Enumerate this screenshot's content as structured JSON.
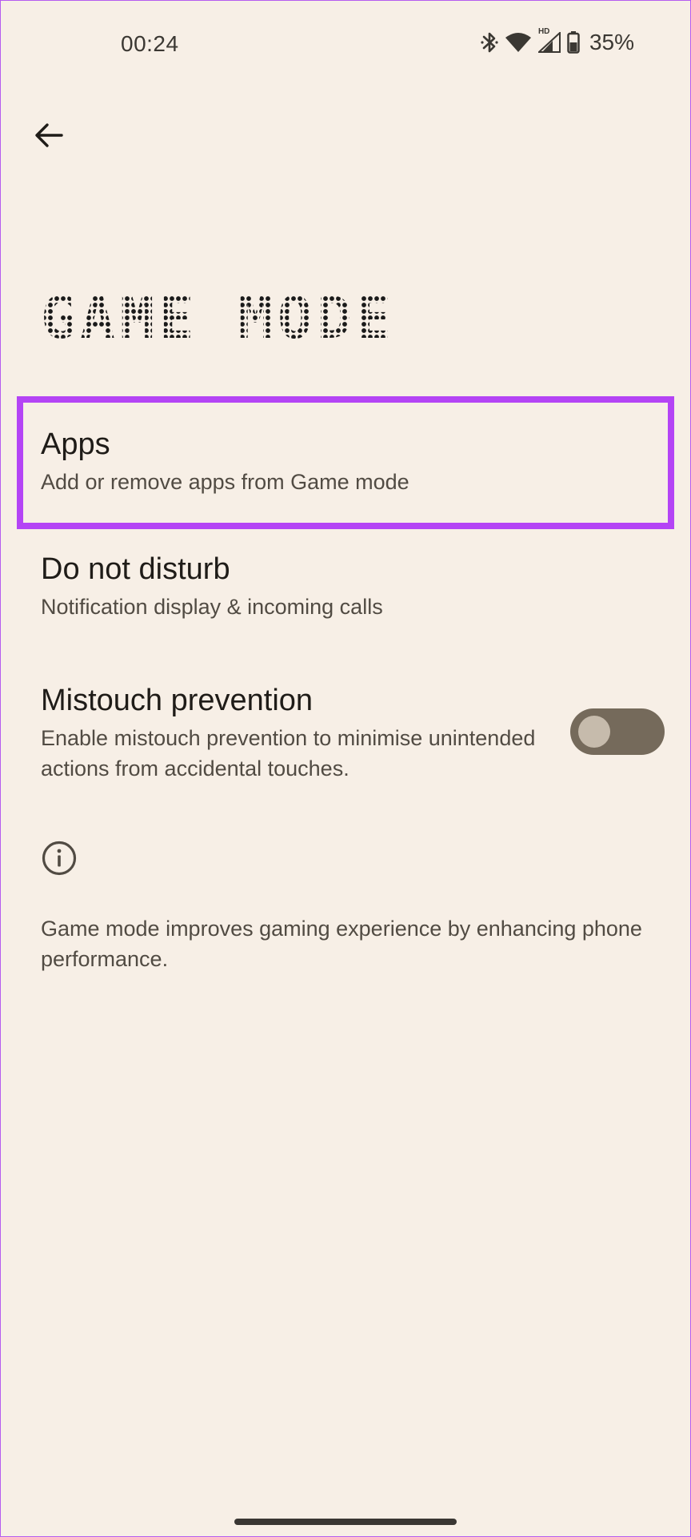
{
  "status_bar": {
    "time": "00:24",
    "network_badge": "HD",
    "battery_percent": "35%",
    "icons": [
      "bluetooth-icon",
      "wifi-icon",
      "cellular-signal-icon",
      "battery-icon"
    ]
  },
  "header": {
    "back_icon": "arrow-left-icon",
    "title": "GAME MODE"
  },
  "settings": [
    {
      "title": "Apps",
      "summary": "Add or remove apps from Game mode",
      "highlighted": true
    },
    {
      "title": "Do not disturb",
      "summary": "Notification display & incoming calls"
    },
    {
      "title": "Mistouch prevention",
      "summary": "Enable mistouch prevention to minimise unintended actions from accidental touches.",
      "toggle_on": false
    }
  ],
  "footer": {
    "icon": "info-icon",
    "text": "Game mode improves gaming experience by enhancing phone performance."
  },
  "colors": {
    "background": "#f7efe6",
    "highlight_border": "#b444f5",
    "toggle_track": "#756a5b",
    "toggle_knob": "#c6bbac",
    "text_primary": "#1f1c18",
    "text_secondary": "#514b43"
  }
}
